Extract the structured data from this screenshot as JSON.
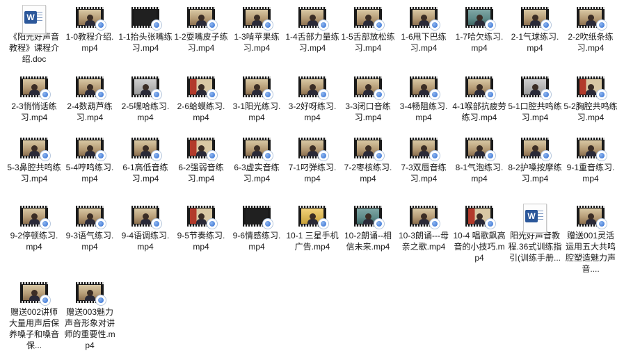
{
  "files": [
    {
      "label": "《阳光好声音教程》课程介绍.doc",
      "type": "doc"
    },
    {
      "label": "1-0教程介绍.mp4",
      "type": "video",
      "frame": "warm"
    },
    {
      "label": "1-1抬头张嘴练习.mp4",
      "type": "video",
      "frame": "dark"
    },
    {
      "label": "1-2耍嘴皮子练习.mp4",
      "type": "video",
      "frame": "warm"
    },
    {
      "label": "1-3啃苹果练习.mp4",
      "type": "video",
      "frame": "warm"
    },
    {
      "label": "1-4舌部力量练习.mp4",
      "type": "video",
      "frame": "warm"
    },
    {
      "label": "1-5舌部放松练习.mp4",
      "type": "video",
      "frame": "warm"
    },
    {
      "label": "1-6甩下巴练习.mp4",
      "type": "video",
      "frame": "warm"
    },
    {
      "label": "1-7哈欠练习.mp4",
      "type": "video",
      "frame": "teal"
    },
    {
      "label": "2-1气球练习.mp4",
      "type": "video",
      "frame": "warm"
    },
    {
      "label": "2-2吹纸条练习.mp4",
      "type": "video",
      "frame": "warm"
    },
    {
      "label": "2-3悄悄话练习.mp4",
      "type": "video",
      "frame": "warm"
    },
    {
      "label": "2-4数葫芦练习.mp4",
      "type": "video",
      "frame": "warm"
    },
    {
      "label": "2-5嘿哈练习.mp4",
      "type": "video",
      "frame": "grey"
    },
    {
      "label": "2-6蛤蟆练习.mp4",
      "type": "video",
      "frame": "red"
    },
    {
      "label": "3-1阳光练习.mp4",
      "type": "video",
      "frame": "warm"
    },
    {
      "label": "3-2好呀练习.mp4",
      "type": "video",
      "frame": "warm"
    },
    {
      "label": "3-3闭口音练习.mp4",
      "type": "video",
      "frame": "warm"
    },
    {
      "label": "3-4畅阻练习.mp4",
      "type": "video",
      "frame": "warm"
    },
    {
      "label": "4-1喉部抗疲劳练习.mp4",
      "type": "video",
      "frame": "warm"
    },
    {
      "label": "5-1口腔共鸣练习.mp4",
      "type": "video",
      "frame": "grey"
    },
    {
      "label": "5-2胸腔共鸣练习.mp4",
      "type": "video",
      "frame": "red"
    },
    {
      "label": "5-3鼻腔共鸣练习.mp4",
      "type": "video",
      "frame": "warm"
    },
    {
      "label": "5-4哼鸣练习.mp4",
      "type": "video",
      "frame": "warm"
    },
    {
      "label": "6-1高低音练习.mp4",
      "type": "video",
      "frame": "warm"
    },
    {
      "label": "6-2强弱音练习.mp4",
      "type": "video",
      "frame": "red"
    },
    {
      "label": "6-3虚实音练习.mp4",
      "type": "video",
      "frame": "warm"
    },
    {
      "label": "7-1叼弹练习.mp4",
      "type": "video",
      "frame": "warm"
    },
    {
      "label": "7-2枣核练习.mp4",
      "type": "video",
      "frame": "warm"
    },
    {
      "label": "7-3双唇音练习.mp4",
      "type": "video",
      "frame": "warm"
    },
    {
      "label": "8-1气泡练习.mp4",
      "type": "video",
      "frame": "warm"
    },
    {
      "label": "8-2护嗓按摩练习.mp4",
      "type": "video",
      "frame": "warm"
    },
    {
      "label": "9-1重音练习.mp4",
      "type": "video",
      "frame": "warm"
    },
    {
      "label": "9-2停顿练习.mp4",
      "type": "video",
      "frame": "warm"
    },
    {
      "label": "9-3语气练习.mp4",
      "type": "video",
      "frame": "warm"
    },
    {
      "label": "9-4语调练习.mp4",
      "type": "video",
      "frame": "warm"
    },
    {
      "label": "9-5节奏练习.mp4",
      "type": "video",
      "frame": "red"
    },
    {
      "label": "9-6情感练习.mp4",
      "type": "video",
      "frame": "dark"
    },
    {
      "label": "10-1 三星手机广告.mp4",
      "type": "video",
      "frame": "gold"
    },
    {
      "label": "10-2朗诵--相信未来.mp4",
      "type": "video",
      "frame": "teal"
    },
    {
      "label": "10-3朗诵---母亲之歌.mp4",
      "type": "video",
      "frame": "warm"
    },
    {
      "label": "10-4 唱歌飙高音的小技巧.mp4",
      "type": "video",
      "frame": "red"
    },
    {
      "label": "阳光好声音教程.36式训练指引(训练手册...",
      "type": "doc"
    },
    {
      "label": "赠送001灵活运用五大共鸣腔塑造魅力声音....",
      "type": "video",
      "frame": "warm"
    },
    {
      "label": "赠送002讲师大量用声后保养嗓子和嗓音保...",
      "type": "video",
      "frame": "warm"
    },
    {
      "label": "赠送003魅力声音形象对讲师的重要性.mp4",
      "type": "video",
      "frame": "warm"
    }
  ]
}
